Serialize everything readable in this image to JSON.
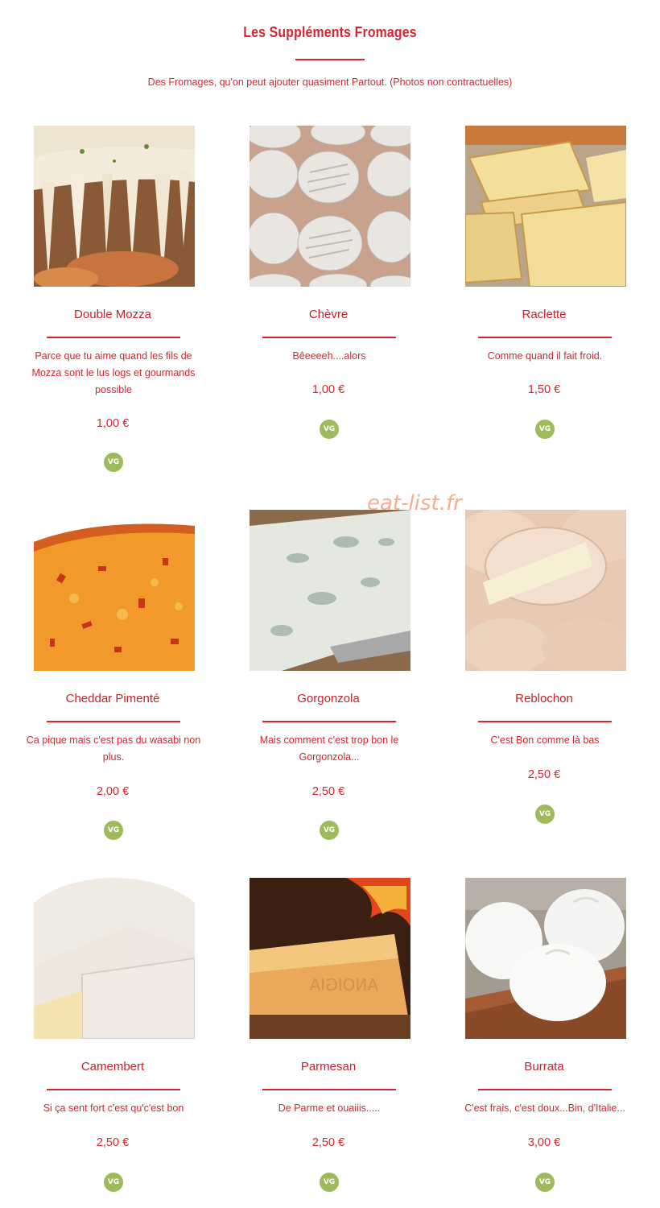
{
  "header": {
    "title": "Les Suppléments Fromages",
    "subtitle": "Des Fromages, qu'on peut ajouter quasiment Partout. (Photos non contractuelles)"
  },
  "watermark": "eat-list.fr",
  "colors": {
    "accent": "#d4252f",
    "vg_badge": "#9dbb5b",
    "watermark": "#f4a07f"
  },
  "items": [
    {
      "name": "Double Mozza",
      "description": "Parce que tu aime quand les fils de Mozza sont le lus logs et gourmands possible",
      "price": "1,00 €",
      "badge": "VG",
      "image": "melted-mozzarella-pizza"
    },
    {
      "name": "Chèvre",
      "description": "Bêeeeeh....alors",
      "price": "1,00 €",
      "badge": "VG",
      "image": "goat-cheese-rounds"
    },
    {
      "name": "Raclette",
      "description": "Comme quand il fait froid.",
      "price": "1,50 €",
      "badge": "VG",
      "image": "raclette-slices"
    },
    {
      "name": "Cheddar Pimenté",
      "description": "Ca pique mais c'est pas du wasabi non plus.",
      "price": "2,00 €",
      "badge": "VG",
      "image": "spicy-cheddar"
    },
    {
      "name": "Gorgonzola",
      "description": "Mais comment c'est trop bon le Gorgonzola...",
      "price": "2,50 €",
      "badge": "VG",
      "image": "gorgonzola-blue-cheese"
    },
    {
      "name": "Reblochon",
      "description": "C'est Bon comme là bas",
      "price": "2,50 €",
      "badge": "VG",
      "image": "reblochon-wheels"
    },
    {
      "name": "Camembert",
      "description": "Si ça sent fort c'est qu'c'est bon",
      "price": "2,50 €",
      "badge": "VG",
      "image": "camembert-wedge"
    },
    {
      "name": "Parmesan",
      "description": "De Parme et ouaiiis.....",
      "price": "2,50 €",
      "badge": "VG",
      "image": "parmesan-block-fire"
    },
    {
      "name": "Burrata",
      "description": "C'est frais, c'est doux...Bin, d'Italie...",
      "price": "3,00 €",
      "badge": "VG",
      "image": "burrata-balls"
    }
  ]
}
